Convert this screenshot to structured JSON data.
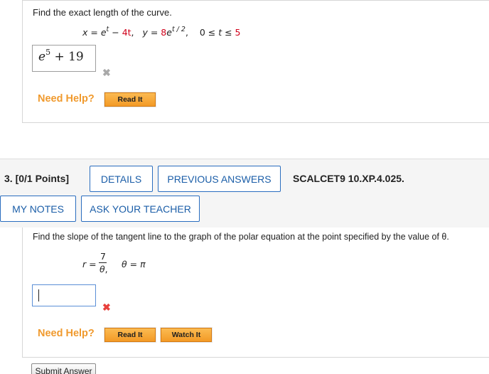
{
  "q2": {
    "prompt": "Find the exact length of the curve.",
    "eq_x_lhs": "x",
    "eq_x_rhs_e": "e",
    "eq_x_rhs_exp": "t",
    "eq_x_rhs_rest": "4t",
    "eq_y_lhs": "y",
    "eq_y_coef": "8",
    "eq_y_e": "e",
    "eq_y_exp": "t / 2",
    "range_t": "t",
    "range_upper": "5",
    "answer_base": "e",
    "answer_exp": "5",
    "answer_rest": " + 19",
    "result": "incorrect",
    "need_help": "Need Help?",
    "read_it": "Read It"
  },
  "q3": {
    "number_points": "3.  [0/1 Points]",
    "details": "DETAILS",
    "previous_answers": "PREVIOUS ANSWERS",
    "code": "SCALCET9 10.XP.4.025.",
    "my_notes": "MY NOTES",
    "ask_teacher": "ASK YOUR TEACHER",
    "prompt": "Find the slope of the tangent line to the graph of the polar equation at the point specified by the value of θ.",
    "r_lhs": "r =",
    "numerator": "7",
    "denominator": "θ",
    "theta_eq": "θ = π",
    "answer_value": "",
    "result": "incorrect",
    "need_help": "Need Help?",
    "read_it": "Read It",
    "watch_it": "Watch It",
    "submit": "Submit Answer"
  },
  "colors": {
    "accent_blue": "#1b5ea8",
    "help_orange": "#f09a2e",
    "error_red": "#e8403c",
    "highlight_red": "#d0021b"
  }
}
